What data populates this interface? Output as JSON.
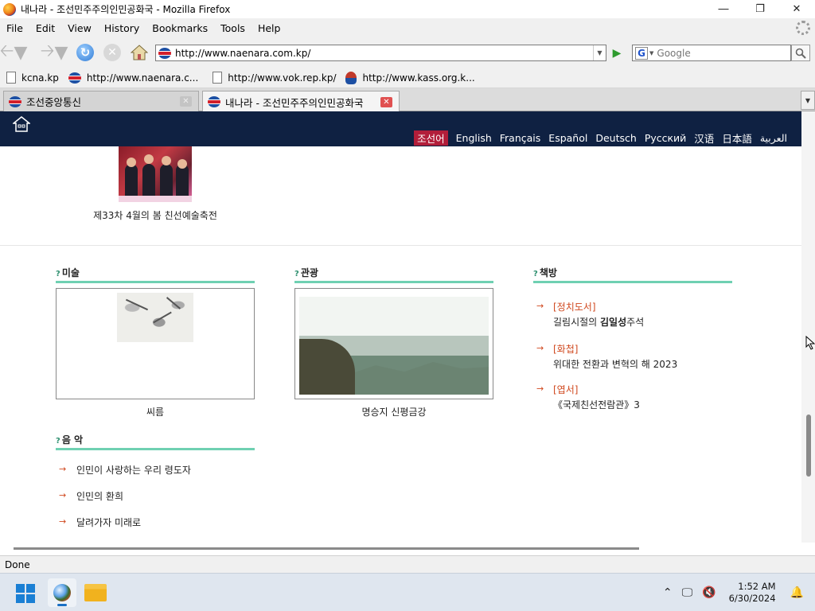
{
  "window": {
    "title": "내나라 - 조선민주주의인민공화국 - Mozilla Firefox"
  },
  "menu": {
    "items": [
      "File",
      "Edit",
      "View",
      "History",
      "Bookmarks",
      "Tools",
      "Help"
    ]
  },
  "nav": {
    "url": "http://www.naenara.com.kp/",
    "search_placeholder": "Google"
  },
  "bookmarks": [
    {
      "label": "kcna.kp"
    },
    {
      "label": "http://www.naenara.c..."
    },
    {
      "label": "http://www.vok.rep.kp/"
    },
    {
      "label": "http://www.kass.org.k..."
    }
  ],
  "tabs": [
    {
      "label": "조선중앙통신"
    },
    {
      "label": "내나라 - 조선민주주의인민공화국"
    }
  ],
  "site": {
    "languages": [
      "조선어",
      "English",
      "Français",
      "Español",
      "Deutsch",
      "Русский",
      "汉语",
      "日本語",
      "العربية"
    ],
    "top_caption": "제33차 4월의 봄 친선예술축전",
    "art": {
      "title": "미술",
      "caption": "씨름"
    },
    "tourism": {
      "title": "관광",
      "caption": "명승지 신평금강"
    },
    "books": {
      "title": "책방",
      "items": [
        {
          "category": "[정치도서]",
          "title_pre": "길림시절의 ",
          "title_bold": "김일성",
          "title_post": "주석"
        },
        {
          "category": "[화첩]",
          "title_pre": "위대한 전환과 변혁의 해 2023",
          "title_bold": "",
          "title_post": ""
        },
        {
          "category": "[엽서]",
          "title_pre": "《국제친선전람관》3",
          "title_bold": "",
          "title_post": ""
        }
      ]
    },
    "music": {
      "title": "음 악",
      "items": [
        "인민이 사랑하는 우리 령도자",
        "인민의 환희",
        "달려가자 미래로"
      ]
    }
  },
  "status": {
    "text": "Done"
  },
  "taskbar": {
    "time": "1:52 AM",
    "date": "6/30/2024"
  },
  "colors": {
    "header_bg": "#0f2142",
    "active_lang_bg": "#b21e3a",
    "section_bar": "#6fd0b2",
    "accent_orange": "#d0481e"
  }
}
